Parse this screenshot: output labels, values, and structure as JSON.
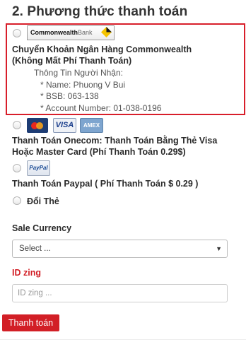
{
  "page_title": "2. Phương thức thanh toán",
  "options": {
    "bank": {
      "logo_text_bold": "Commonwealth",
      "logo_text_light": "Bank",
      "title_line1": "Chuyển Khoản Ngân Hàng Commonwealth",
      "title_line2": "(Không Mất Phí Thanh Toán)",
      "receiver_heading": "Thông Tin Người Nhận:",
      "name_line": "* Name: Phuong V Bui",
      "bsb_line": "* BSB: 063-138",
      "account_line": "* Account Number: 01-038-0196"
    },
    "onecom": {
      "card_visa": "VISA",
      "card_amex": "AMEX",
      "title_line1": "Thanh Toán Onecom: Thanh Toán Bằng Thẻ Visa",
      "title_line2": "Hoặc Master Card (Phí Thanh Toán 0.29$)"
    },
    "paypal": {
      "card_paypal": "PayPal",
      "title": "Thanh Toán Paypal ( Phí Thanh Toán $ 0.29 )"
    },
    "doi_the": {
      "title": "Đổi Thẻ"
    }
  },
  "sale_currency": {
    "label": "Sale Currency",
    "selected": "Select ..."
  },
  "id_zing": {
    "label": "ID zing",
    "placeholder": "ID zing ..."
  },
  "submit_label": "Thanh toán",
  "colors": {
    "accent_red": "#d21f26",
    "highlight_border": "#d81e2a"
  }
}
